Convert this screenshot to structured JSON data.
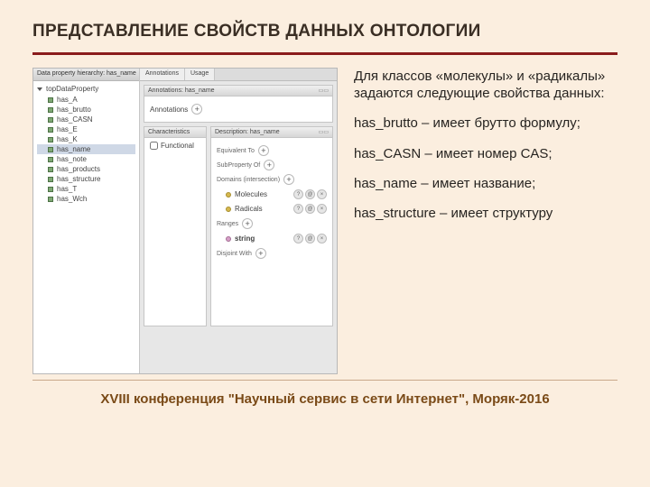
{
  "title": "ПРЕДСТАВЛЕНИЕ СВОЙСТВ ДАННЫХ ОНТОЛОГИИ",
  "footer": "XVIII конференция \"Научный сервис в сети Интернет\", Моряк-2016",
  "text": {
    "intro": "Для классов «молекулы» и «радикалы» задаются следующие свойства данных:",
    "p1": "has_brutto – имеет брутто формулу;",
    "p2": "has_CASN – имеет номер CAS;",
    "p3": "has_name – имеет название;",
    "p4": "has_structure – имеет структуру"
  },
  "editor": {
    "treeHeader": "Data property hierarchy: has_name",
    "root": "topDataProperty",
    "items": [
      "has_A",
      "has_brutto",
      "has_CASN",
      "has_E",
      "has_K",
      "has_name",
      "has_note",
      "has_products",
      "has_structure",
      "has_T",
      "has_Wch"
    ],
    "selected": "has_name",
    "tabs": {
      "a": "Annotations",
      "b": "Usage"
    },
    "annHdr": "Annotations: has_name",
    "annLabel": "Annotations",
    "charHdr": "Characteristics",
    "descHdr": "Description: has_name",
    "functional": "Functional",
    "sections": {
      "equiv": "Equivalent To",
      "sub": "SubProperty Of",
      "dom": "Domains (intersection)",
      "rng": "Ranges",
      "dis": "Disjoint With"
    },
    "domains": {
      "a": "Molecules",
      "b": "Radicals"
    },
    "range": "string"
  }
}
